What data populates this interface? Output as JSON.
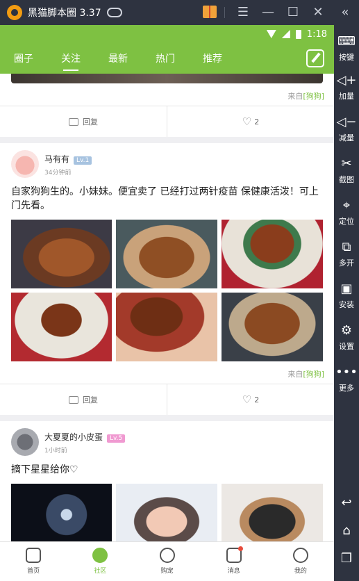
{
  "emulator": {
    "title": "黑猫脚本圈 3.37",
    "icons": [
      "gamepad-icon",
      "gift-icon",
      "menu-icon",
      "minimize-icon",
      "maximize-icon",
      "close-icon",
      "collapse-icon"
    ],
    "toolbar": [
      {
        "label": "按键",
        "icon": "keyboard-icon"
      },
      {
        "label": "加量",
        "icon": "volume-up-icon"
      },
      {
        "label": "减量",
        "icon": "volume-down-icon"
      },
      {
        "label": "截图",
        "icon": "scissors-icon"
      },
      {
        "label": "定位",
        "icon": "location-icon"
      },
      {
        "label": "多开",
        "icon": "multi-open-icon"
      },
      {
        "label": "安装",
        "icon": "apk-install-icon"
      },
      {
        "label": "设置",
        "icon": "gear-icon"
      },
      {
        "label": "更多",
        "icon": "more-icon"
      }
    ],
    "nav_icons": [
      "back-icon",
      "home-icon",
      "recent-apps-icon"
    ]
  },
  "status_bar": {
    "time": "1:18"
  },
  "app_bar": {
    "tabs": [
      "圈子",
      "关注",
      "最新",
      "热门",
      "推荐"
    ],
    "active_tab": "关注"
  },
  "feed": {
    "top_card": {
      "source_prefix": "来自",
      "source_tag": "[狗狗]",
      "reply_label": "回复",
      "likes": "2"
    },
    "posts": [
      {
        "user": "马有有",
        "level": "Lv.1",
        "level_color": "#a7c3e0",
        "time": "34分钟前",
        "text": "自家狗狗生的。小妹妹。便宜卖了 已经打过两针疫苗 保健康活泼！可上门先看。",
        "source_prefix": "来自",
        "source_tag": "[狗狗]",
        "reply_label": "回复",
        "likes": "2"
      },
      {
        "user": "大夏夏的小皮蛋",
        "level": "Lv.5",
        "level_color": "#f09ad1",
        "time": "1小时前",
        "text": "摘下星星给你♡"
      }
    ]
  },
  "bottom_nav": {
    "items": [
      "首页",
      "社区",
      "购宠",
      "消息",
      "我的"
    ],
    "active": "社区"
  },
  "colors": {
    "brand": "#7ec142",
    "emulator_bg": "#2e3340",
    "notify": "#e74c3c"
  }
}
